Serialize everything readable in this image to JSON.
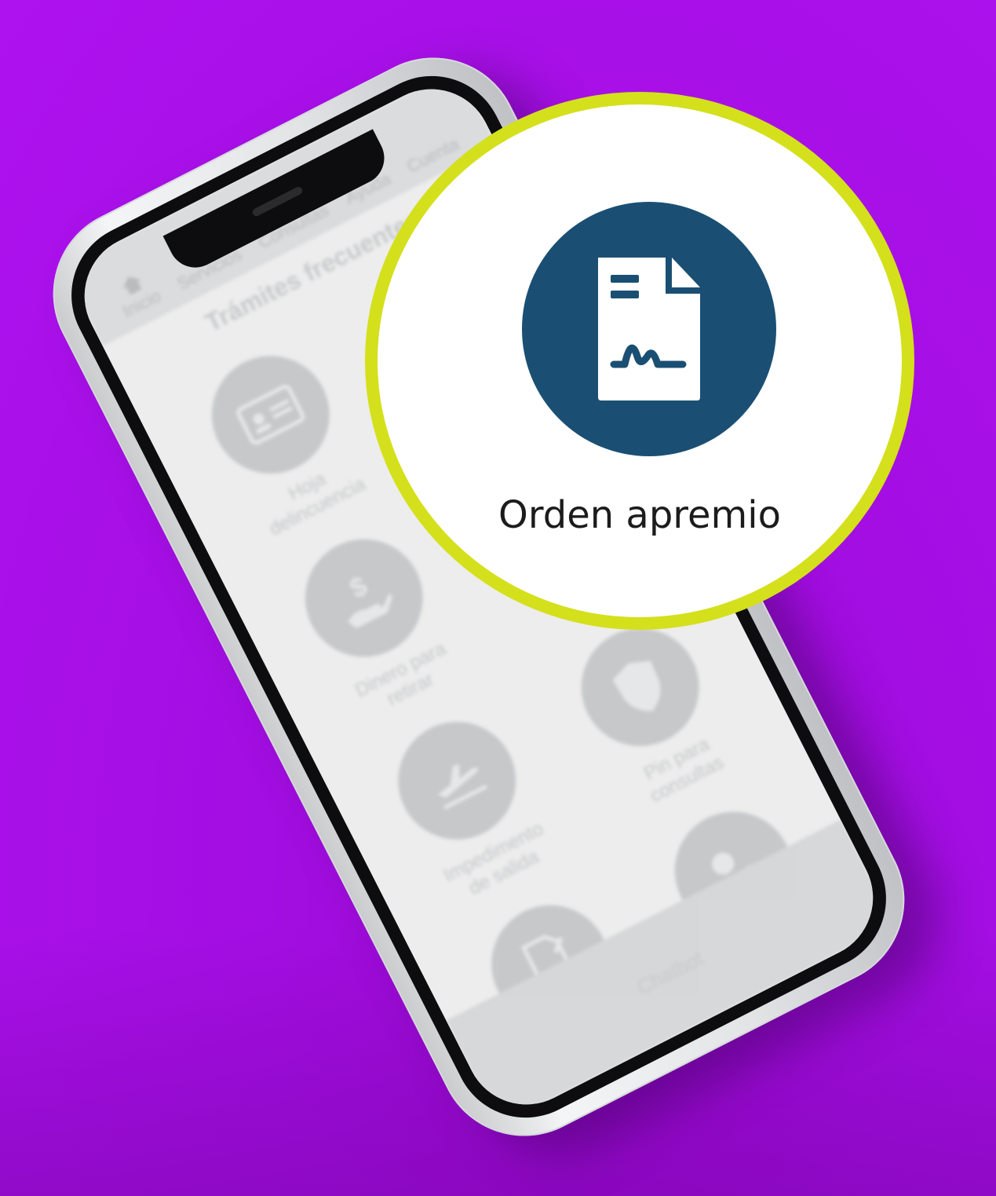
{
  "nav": {
    "items": [
      {
        "label": "Inicio",
        "icon": "home-icon"
      },
      {
        "label": "Servicios"
      },
      {
        "label": "Consultas"
      },
      {
        "label": "Ayuda"
      },
      {
        "label": "Cuenta"
      }
    ]
  },
  "main": {
    "section_title": "Trámites frecuentes",
    "tiles": [
      {
        "label": "Hoja delincuencia",
        "icon": "id-card-icon"
      },
      {
        "label": "",
        "icon": "blank-icon"
      },
      {
        "label": "Dinero para retirar",
        "icon": "money-hand-icon"
      },
      {
        "label": "",
        "icon": "blank-icon"
      },
      {
        "label": "Impedimento de salida",
        "icon": "plane-departure-icon"
      },
      {
        "label": "Pin para consultas",
        "icon": "shield-icon"
      },
      {
        "label": "",
        "icon": "document-sign-icon"
      },
      {
        "label": "",
        "icon": "user-settings-icon"
      }
    ]
  },
  "bottom_bar": {
    "chatbot_label": "Chatbot"
  },
  "callout": {
    "label": "Orden apremio",
    "icon": "document-signature-icon",
    "colors": {
      "ring": "#d4e01b",
      "icon_circle": "#1a4f73"
    }
  },
  "colors": {
    "background": "#ae12ef"
  }
}
